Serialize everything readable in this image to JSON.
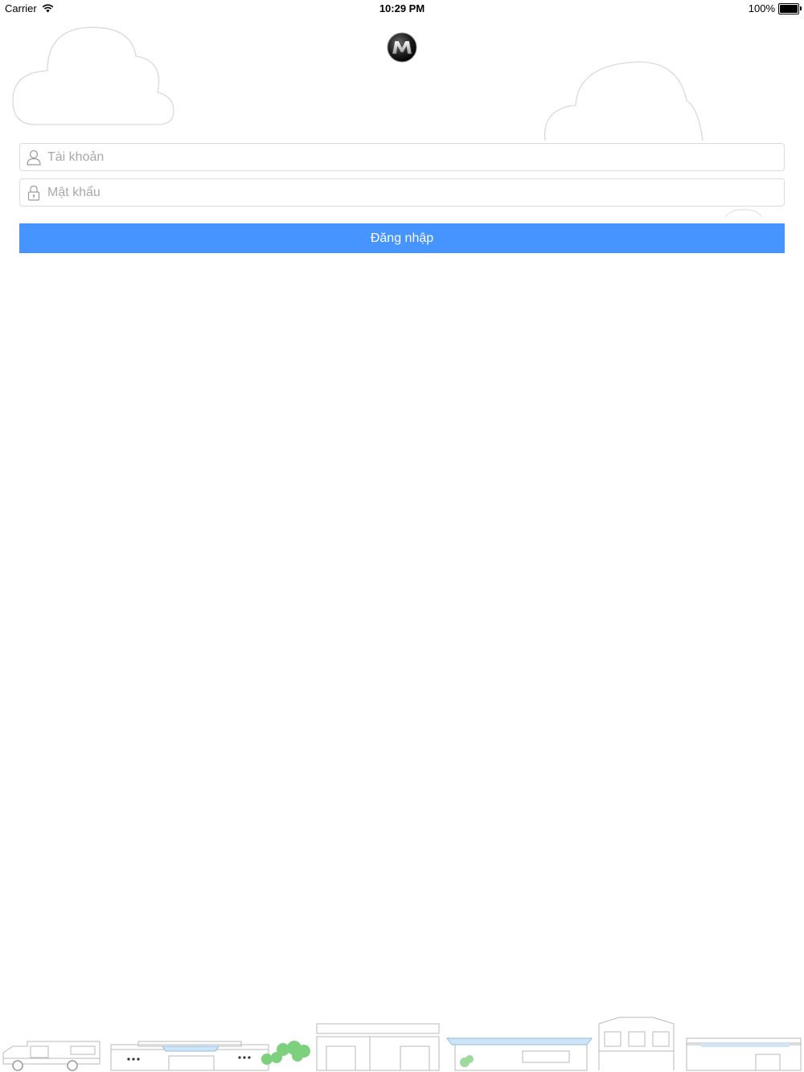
{
  "status_bar": {
    "carrier": "Carrier",
    "time": "10:29 PM",
    "battery": "100%"
  },
  "logo": {
    "letter": "M"
  },
  "form": {
    "username_placeholder": "Tài khoản",
    "username_value": "",
    "password_placeholder": "Mật khẩu",
    "password_value": "",
    "login_label": "Đăng nhập"
  },
  "colors": {
    "primary": "#4594ff",
    "border": "#dcdcdc",
    "placeholder": "#a8a8a8",
    "cloud_stroke": "#d9d9d9"
  },
  "icons": {
    "username": "user-icon",
    "password": "lock-icon",
    "wifi": "wifi-icon",
    "battery": "battery-icon"
  }
}
